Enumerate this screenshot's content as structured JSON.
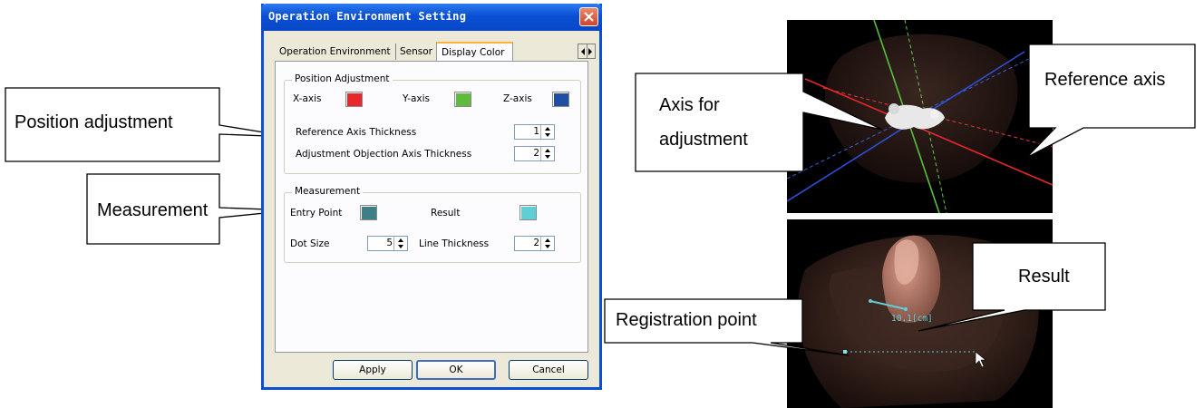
{
  "window": {
    "title": "Operation Environment Setting"
  },
  "tabs": [
    {
      "label": "Operation Environment"
    },
    {
      "label": "Sensor"
    },
    {
      "label": "Display Color",
      "active": true
    }
  ],
  "position_group": {
    "title": "Position Adjustment",
    "x_axis_label": "X-axis",
    "y_axis_label": "Y-axis",
    "z_axis_label": "Z-axis",
    "x_axis_color": "#e8262c",
    "y_axis_color": "#5dbc3e",
    "z_axis_color": "#1f4ea6",
    "ref_thickness_label": "Reference Axis Thickness",
    "ref_thickness_value": "1",
    "adj_thickness_label": "Adjustment Objection Axis Thickness",
    "adj_thickness_value": "2"
  },
  "measurement_group": {
    "title": "Measurement",
    "entry_point_label": "Entry Point",
    "entry_point_color": "#3e7f86",
    "result_label": "Result",
    "result_color": "#5fcfd6",
    "dot_size_label": "Dot Size",
    "dot_size_value": "5",
    "line_thickness_label": "Line Thickness",
    "line_thickness_value": "2"
  },
  "buttons": {
    "apply": "Apply",
    "ok": "OK",
    "cancel": "Cancel"
  },
  "callouts": {
    "position_adjustment": "Position adjustment",
    "measurement": "Measurement",
    "axis_for_adjustment_line1": "Axis for",
    "axis_for_adjustment_line2": "adjustment",
    "reference_axis": "Reference axis",
    "result": "Result",
    "registration_point": "Registration point"
  },
  "view_bottom": {
    "measurement_text": "10.1[cm]"
  }
}
